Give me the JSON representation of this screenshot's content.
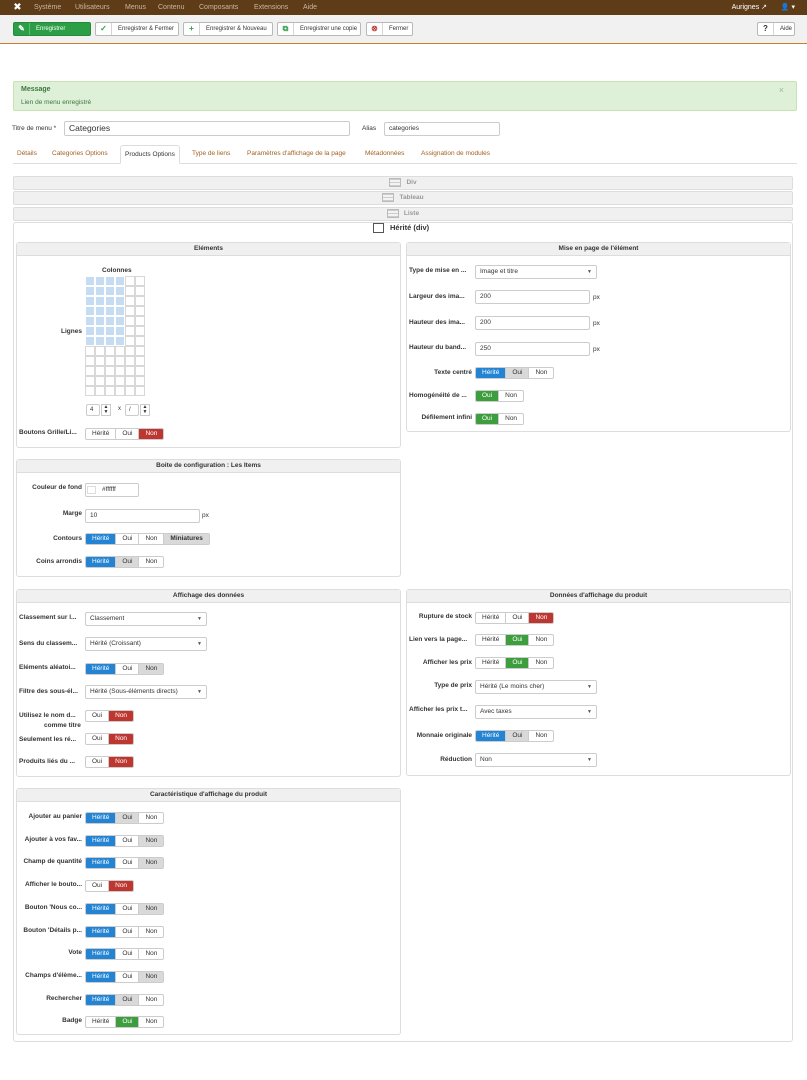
{
  "topnav": {
    "items": [
      "Système",
      "Utilisateurs",
      "Menus",
      "Contenu",
      "Composants",
      "Extensions",
      "Aide"
    ],
    "site": "Aurignes ↗",
    "user": "👤 ▾"
  },
  "toolbar": {
    "save": "Enregistrer",
    "save_close": "Enregistrer & Fermer",
    "save_new": "Enregistrer & Nouveau",
    "save_copy": "Enregistrer une copie",
    "close": "Fermer",
    "help": "Aide"
  },
  "message": {
    "heading": "Message",
    "body": "Lien de menu enregistré",
    "close": "×"
  },
  "form": {
    "title_label": "Titre de menu *",
    "title_value": "Categories",
    "alias_label": "Alias",
    "alias_value": "categories"
  },
  "tabs": [
    "Détails",
    "Categories Options",
    "Products Options",
    "Type de liens",
    "Paramètres d'affichage de la page",
    "Métadonnées",
    "Assignation de modules"
  ],
  "layout_strips": {
    "div": "Div",
    "tableau": "Tableau",
    "liste": "Liste",
    "herite": "Hérité (div)"
  },
  "elements": {
    "title": "Eléments",
    "colonnes": "Colonnes",
    "lignes": "Lignes",
    "rows_value": "4",
    "x": "x",
    "cols_value": "/",
    "buttons_label": "Boutons Grille/Li...",
    "buttons": [
      "Hérité",
      "Oui",
      "Non"
    ]
  },
  "mise_en_page": {
    "title": "Mise en page de l'élément",
    "type_label": "Type de mise en ...",
    "type_value": "Image et titre",
    "largeur_label": "Largeur des ima...",
    "largeur_value": "200",
    "hauteur_label": "Hauteur des ima...",
    "hauteur_value": "200",
    "bandeau_label": "Hauteur du band...",
    "bandeau_value": "250",
    "px": "px",
    "texte_centre_label": "Texte centré",
    "homog_label": "Homogénéité de ...",
    "defilement_label": "Défilement infini",
    "opt_h": "Hérité",
    "opt_o": "Oui",
    "opt_n": "Non"
  },
  "config": {
    "title": "Boite de configuration : Les Items",
    "couleur_label": "Couleur de fond",
    "couleur_value": "#ffffff",
    "marge_label": "Marge",
    "marge_value": "10",
    "px": "px",
    "contours_label": "Contours",
    "contours": [
      "Hérité",
      "Oui",
      "Non",
      "Miniatures"
    ],
    "coins_label": "Coins arrondis",
    "coins": [
      "Hérité",
      "Oui",
      "Non"
    ]
  },
  "affichage": {
    "title": "Affichage des données",
    "classement_label": "Classement sur l...",
    "classement_value": "Classement",
    "sens_label": "Sens du classem...",
    "sens_value": "Hérité (Croissant)",
    "aleat_label": "Eléments aléatoi...",
    "aleat": [
      "Hérité",
      "Oui",
      "Non"
    ],
    "filtre_label": "Filtre des sous-él...",
    "filtre_value": "Hérité (Sous-éléments directs)",
    "nom_label": "Utilisez le nom d...",
    "nom_label2": "comme titre",
    "seul_label": "Seulement les ré...",
    "lies_label": "Produits liés du ...",
    "on": [
      "Oui",
      "Non"
    ]
  },
  "donnees_produit": {
    "title": "Données d'affichage du produit",
    "rupture_label": "Rupture de stock",
    "lien_label": "Lien vers la page...",
    "prix_label": "Afficher les prix",
    "typeprix_label": "Type de prix",
    "typeprix_value": "Hérité (Le moins cher)",
    "prixt_label": "Afficher les prix t...",
    "prixt_value": "Avec taxes",
    "monnaie_label": "Monnaie originale",
    "reduction_label": "Réduction",
    "reduction_value": "Non",
    "opts": [
      "Hérité",
      "Oui",
      "Non"
    ]
  },
  "caracteristique": {
    "title": "Caractéristique d'affichage du produit",
    "rows": [
      {
        "label": "Ajouter au panier",
        "opts": [
          "Hérité",
          "Oui",
          "Non"
        ],
        "sel": 0,
        "sec": 1
      },
      {
        "label": "Ajouter à vos fav...",
        "opts": [
          "Hérité",
          "Oui",
          "Non"
        ],
        "sel": 0,
        "sec": 2
      },
      {
        "label": "Champ de quantité",
        "opts": [
          "Hérité",
          "Oui",
          "Non"
        ],
        "sel": 0,
        "sec": 2
      },
      {
        "label": "Afficher le bouto...",
        "opts": [
          "Oui",
          "Non"
        ],
        "sel": -1,
        "red": 1
      },
      {
        "label": "Bouton 'Nous co...",
        "opts": [
          "Hérité",
          "Oui",
          "Non"
        ],
        "sel": 0,
        "sec": 2
      },
      {
        "label": "Bouton 'Détails p...",
        "opts": [
          "Hérité",
          "Oui",
          "Non"
        ],
        "sel": 0
      },
      {
        "label": "Vote",
        "opts": [
          "Hérité",
          "Oui",
          "Non"
        ],
        "sel": 0
      },
      {
        "label": "Champs d'élème...",
        "opts": [
          "Hérité",
          "Oui",
          "Non"
        ],
        "sel": 0,
        "sec": 2
      },
      {
        "label": "Rechercher",
        "opts": [
          "Hérité",
          "Oui",
          "Non"
        ],
        "sel": 0,
        "sec": 1
      },
      {
        "label": "Badge",
        "opts": [
          "Hérité",
          "Oui",
          "Non"
        ],
        "green": 1
      }
    ]
  }
}
